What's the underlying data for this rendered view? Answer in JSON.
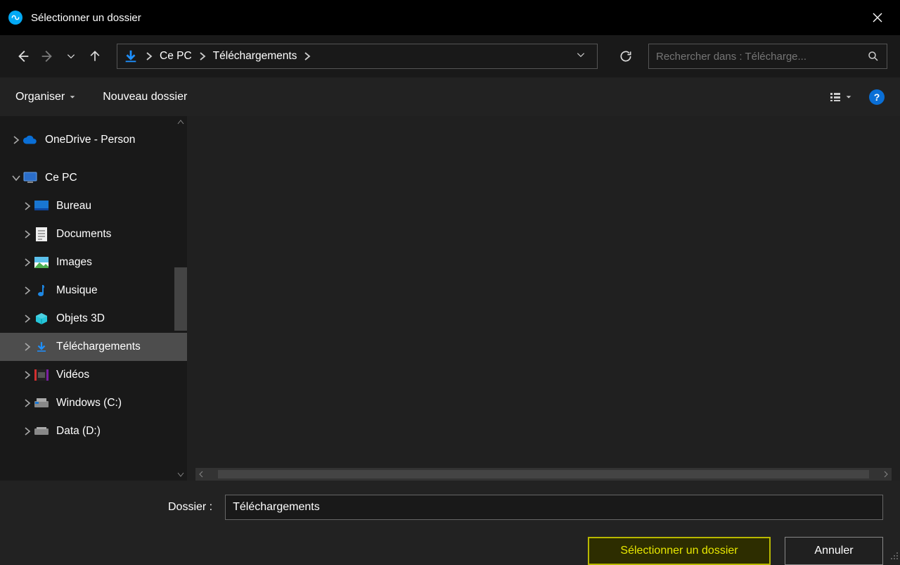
{
  "window": {
    "title": "Sélectionner un dossier"
  },
  "breadcrumb": {
    "seg1": "Ce PC",
    "seg2": "Téléchargements"
  },
  "search": {
    "placeholder": "Rechercher dans : Télécharge..."
  },
  "toolbar": {
    "organise": "Organiser",
    "new_folder": "Nouveau dossier"
  },
  "tree": {
    "onedrive": "OneDrive - Person",
    "cepc": "Ce PC",
    "bureau": "Bureau",
    "documents": "Documents",
    "images": "Images",
    "musique": "Musique",
    "objets3d": "Objets 3D",
    "telechargements": "Téléchargements",
    "videos": "Vidéos",
    "windows_c": "Windows (C:)",
    "data_d": "Data (D:)"
  },
  "footer": {
    "label": "Dossier :",
    "value": "Téléchargements",
    "select": "Sélectionner un dossier",
    "cancel": "Annuler"
  },
  "help_char": "?"
}
